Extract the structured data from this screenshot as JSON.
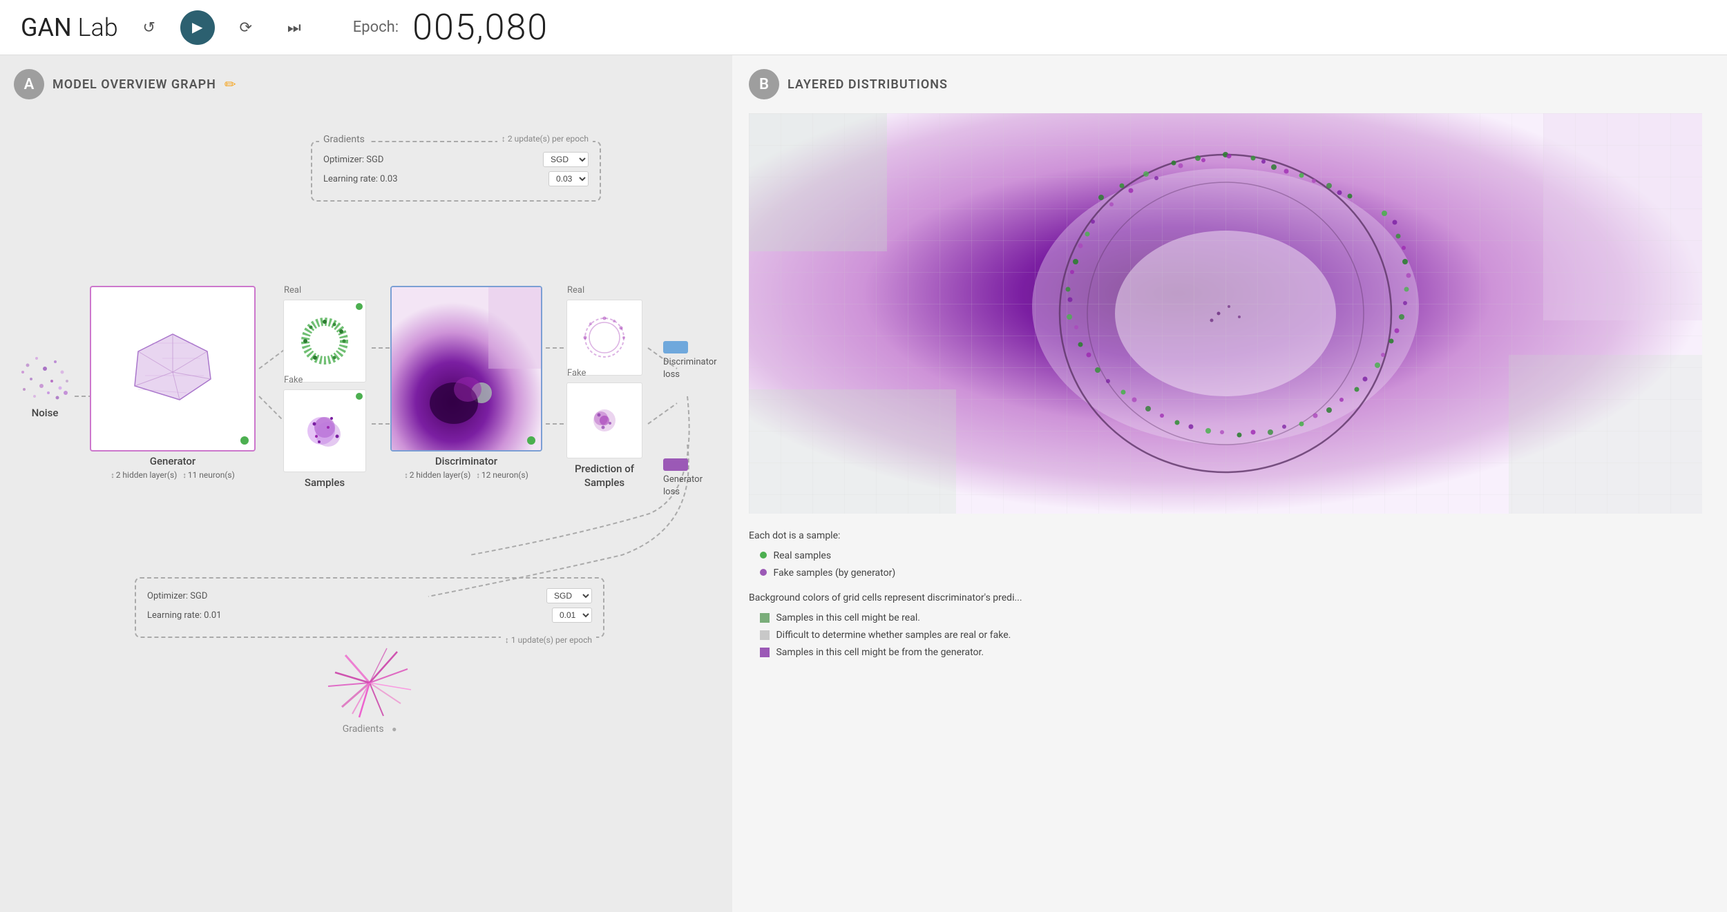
{
  "header": {
    "title_bold": "GAN",
    "title_rest": " Lab",
    "epoch_label": "Epoch:",
    "epoch_value": "005,080",
    "play_icon": "▶",
    "reset_icon": "↺",
    "step_icon": "↻",
    "skip_icon": "⏭"
  },
  "panel_a": {
    "badge": "A",
    "title": "MODEL OVERVIEW GRAPH",
    "edit_icon": "✏",
    "nodes": {
      "noise_label": "Noise",
      "generator_label": "Generator",
      "generator_sublabel": "↕ 2 hidden layer(s)  ↕ 11 neuron(s)",
      "generator_status_color": "#4caf50",
      "samples_label": "Samples",
      "real_label": "Real",
      "fake_label": "Fake",
      "discriminator_label": "Discriminator",
      "discriminator_sublabel": "↕ 2 hidden layer(s)  ↕ 12 neuron(s)",
      "discriminator_status_color": "#4caf50",
      "prediction_label": "Prediction of",
      "prediction_label2": "Samples",
      "pred_real_label": "Real",
      "pred_fake_label": "Fake"
    },
    "gradients_top": {
      "title": "Gradients",
      "updates_label": "↕ 2 update(s) per epoch",
      "optimizer_label": "Optimizer: SGD",
      "optimizer_value": "SGD",
      "lr_label": "Learning rate: 0.03",
      "lr_value": "0.03"
    },
    "gradients_bottom": {
      "optimizer_label": "Optimizer: SGD",
      "optimizer_value": "SGD",
      "lr_label": "Learning rate: 0.01",
      "lr_value": "0.01",
      "updates_label": "↕ 1 update(s) per epoch",
      "title": "Gradients"
    },
    "losses": {
      "discriminator_label": "Discriminator\nloss",
      "discriminator_color": "#6fa8dc",
      "generator_label": "Generator\nloss",
      "generator_color": "#9b59b6"
    }
  },
  "panel_b": {
    "badge": "B",
    "title": "LAYERED DISTRIBUTIONS",
    "legend": {
      "dot_intro": "Each dot is a sample:",
      "real_dot_color": "#4caf50",
      "real_label": "Real samples",
      "fake_dot_color": "#9b59b6",
      "fake_label": "Fake samples (by generator)",
      "bg_intro": "Background colors of grid cells represent discriminator's predi...",
      "green_sq_color": "#7aad7a",
      "green_label": "Samples in this cell might be real.",
      "gray_sq_color": "#c8c8c8",
      "gray_label": "Difficult to determine whether samples are real or fake.",
      "purple_sq_color": "#9b59b6",
      "purple_label": "Samples in this cell might be from the generator."
    }
  }
}
